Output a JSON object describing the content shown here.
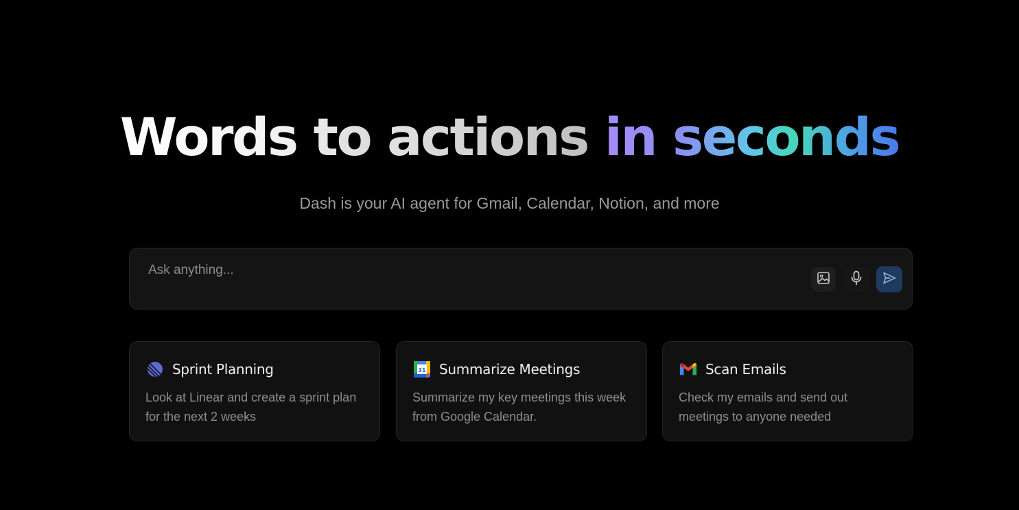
{
  "hero": {
    "headline": {
      "part1": "Words to ",
      "part2": "actions ",
      "part3": "in seconds"
    },
    "subtitle": "Dash is your AI agent for Gmail, Calendar, Notion, and more"
  },
  "prompt": {
    "placeholder": "Ask anything...",
    "value": "",
    "buttons": {
      "image": "image-icon",
      "mic": "microphone-icon",
      "send": "send-icon"
    }
  },
  "cards": [
    {
      "icon": "linear-logo-icon",
      "title": "Sprint Planning",
      "description": "Look at Linear and create a sprint plan for the next 2 weeks"
    },
    {
      "icon": "google-calendar-icon",
      "title": "Summarize Meetings",
      "description": "Summarize my key meetings this week from Google Calendar."
    },
    {
      "icon": "gmail-icon",
      "title": "Scan Emails",
      "description": "Check my emails and send out meetings to anyone needed"
    }
  ],
  "calendar_icon_day": "31",
  "colors": {
    "background": "#000000",
    "accent_gradient_start": "#a78bfa",
    "accent_gradient_mid": "#45d6b8",
    "accent_gradient_end": "#4a78ea",
    "send_button": "#1f3a5f"
  }
}
